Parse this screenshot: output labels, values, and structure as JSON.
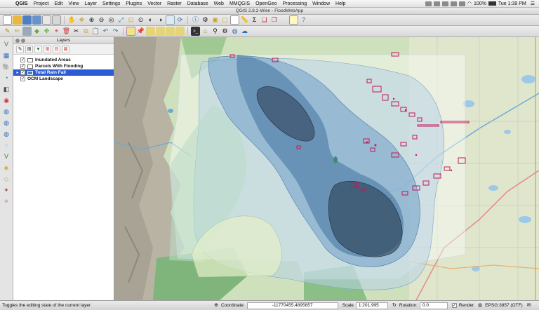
{
  "menubar": {
    "app": "QGIS",
    "items": [
      "Project",
      "Edit",
      "View",
      "Layer",
      "Settings",
      "Plugins",
      "Vector",
      "Raster",
      "Database",
      "Web",
      "MMQGIS",
      "OpenGeo",
      "Processing",
      "Window",
      "Help"
    ],
    "battery": "100%",
    "clock": "Tue 1:39 PM"
  },
  "window": {
    "title": "QGIS 2.8.2-Wien - FloodWebApp"
  },
  "layers_panel": {
    "title": "Layers",
    "layers": [
      {
        "name": "Inundated Areas",
        "checked": true,
        "selected": false,
        "swatch": "#ffffff"
      },
      {
        "name": "Parcels With Flooding",
        "checked": true,
        "selected": false,
        "swatch": "#ffffff"
      },
      {
        "name": "Total Rain Fall",
        "checked": true,
        "selected": true,
        "swatch": "#4d7ea8"
      },
      {
        "name": "OCM Landscape",
        "checked": true,
        "selected": false,
        "swatch": ""
      }
    ]
  },
  "statusbar": {
    "message": "Toggles the editing state of the current layer",
    "coordinate_label": "Coordinate:",
    "coordinate_value": "-11770455,4895857",
    "scale_label": "Scale",
    "scale_value": "1:201,995",
    "rotation_label": "Rotation:",
    "rotation_value": "0.0",
    "render_label": "Render",
    "render_checked": true,
    "crs": "EPSG:3857 (OTF)"
  },
  "colors": {
    "selection": "#2b5bd7",
    "rain_outer": "#b8d2e6",
    "rain_mid": "#6f9fc8",
    "rain_inner": "#2f6494",
    "rain_core": "#2b3d52",
    "parcels": "#c2185b"
  },
  "icons": {
    "toolbar1": [
      "new-project-icon",
      "open-project-icon",
      "save-project-icon",
      "save-as-icon",
      "new-print-composer-icon",
      "composer-manager-icon",
      "pan-icon",
      "pan-to-selection-icon",
      "zoom-in-icon",
      "zoom-out-icon",
      "zoom-native-icon",
      "zoom-full-icon",
      "zoom-to-selection-icon",
      "zoom-to-layer-icon",
      "zoom-last-icon",
      "zoom-next-icon",
      "new-map-view-icon",
      "refresh-icon",
      "identify-icon",
      "run-action-icon",
      "select-feature-icon",
      "deselect-icon",
      "open-attribute-table-icon",
      "measure-icon",
      "statistics-icon",
      "new-bookmark-icon",
      "show-bookmarks-icon",
      "map-tips-icon",
      "text-annotation-icon",
      "help-icon"
    ],
    "toolbar2": [
      "current-edits-icon",
      "toggle-editing-icon",
      "save-edits-icon",
      "add-feature-icon",
      "move-feature-icon",
      "node-tool-icon",
      "delete-selected-icon",
      "cut-features-icon",
      "copy-features-icon",
      "paste-features-icon",
      "undo-icon",
      "redo-icon",
      "label-toolbar-icon",
      "pin-labels-icon",
      "show-hide-labels-icon",
      "move-label-icon",
      "rotate-label-icon",
      "change-label-icon",
      "python-console-icon",
      "osm-icon",
      "plugin-binoculars-icon",
      "plugin-gear-icon",
      "globe-icon",
      "cloud-plugin-icon"
    ],
    "left": [
      "add-vector-layer-icon",
      "add-raster-layer-icon",
      "add-postgis-layer-icon",
      "add-spatialite-layer-icon",
      "add-mssql-layer-icon",
      "add-oracle-layer-icon",
      "add-wms-layer-icon",
      "add-wcs-layer-icon",
      "add-wfs-layer-icon",
      "add-delimited-text-icon",
      "new-shapefile-icon",
      "new-spatialite-icon",
      "add-virtual-layer-icon",
      "add-gpx-icon",
      "new-temporary-layer-icon"
    ]
  }
}
